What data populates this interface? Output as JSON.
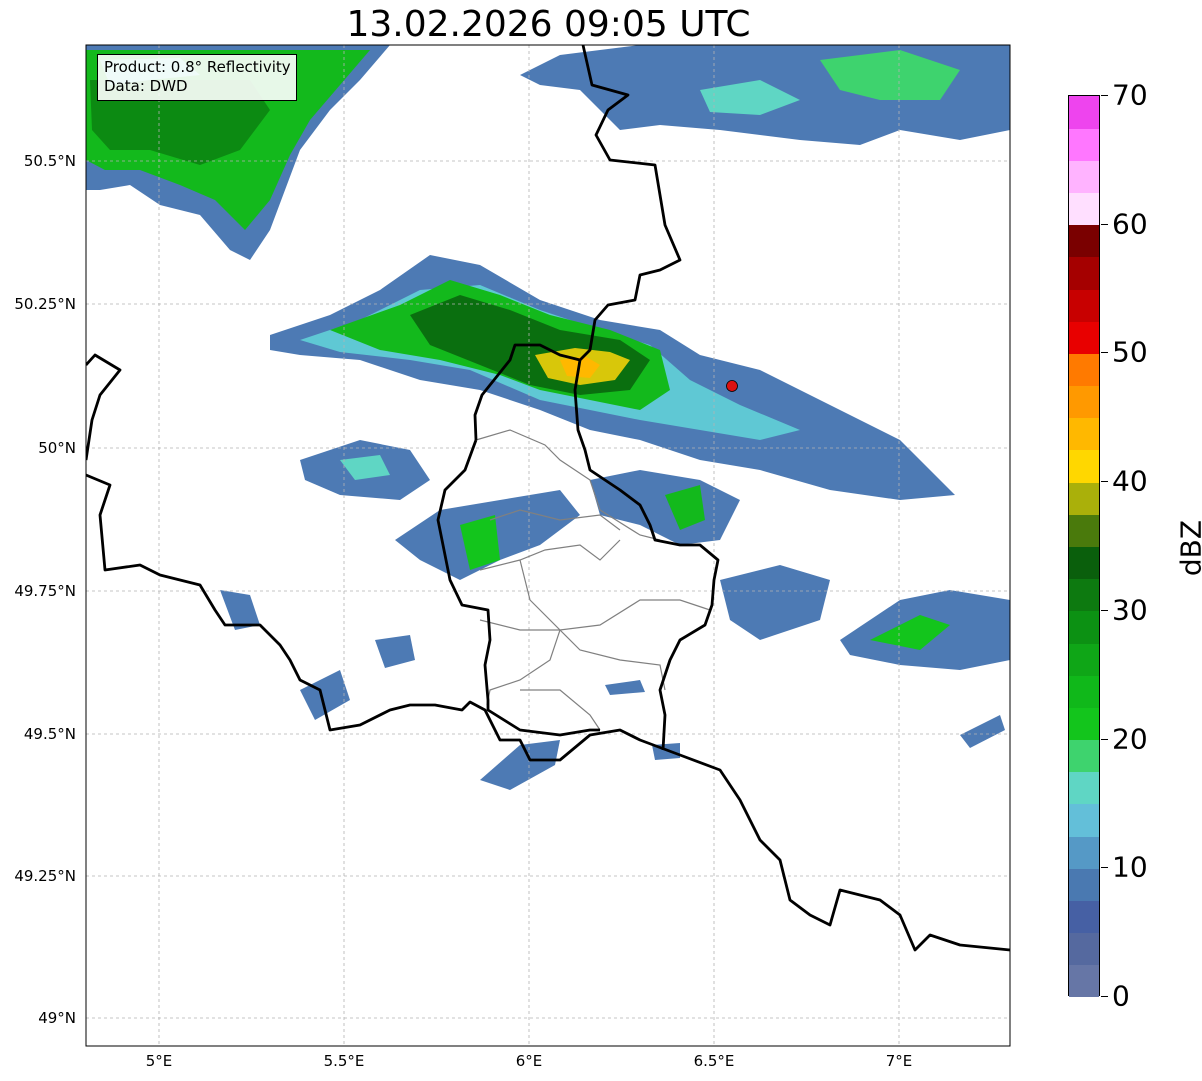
{
  "title": "13.02.2026 09:05 UTC",
  "infobox": {
    "line1": "Product: 0.8° Reflectivity",
    "line2": "Data: DWD"
  },
  "axes": {
    "x_ticks": [
      "5°E",
      "5.5°E",
      "6°E",
      "6.5°E",
      "7°E"
    ],
    "y_ticks": [
      "50.5°N",
      "50.25°N",
      "50°N",
      "49.75°N",
      "49.5°N",
      "49.25°N",
      "49°N"
    ],
    "lon_range": [
      4.8,
      7.3
    ],
    "lat_range": [
      48.95,
      50.7
    ]
  },
  "colorbar": {
    "label": "dBZ",
    "ticks": [
      "0",
      "10",
      "20",
      "30",
      "40",
      "50",
      "60",
      "70"
    ],
    "range": [
      0,
      70
    ],
    "step": 2.5,
    "colors": [
      "#6676a6",
      "#55699f",
      "#4660a4",
      "#4a79b1",
      "#5599c6",
      "#63bfd9",
      "#5fd6c4",
      "#3ed36e",
      "#13c51c",
      "#10b81a",
      "#0fa617",
      "#0c9113",
      "#0d7a10",
      "#0a5f0c",
      "#4a7a0c",
      "#aab00a",
      "#ffd700",
      "#ffb800",
      "#ff9900",
      "#ff7a00",
      "#e80000",
      "#c80000",
      "#a50000",
      "#7a0000",
      "#ffdfff",
      "#ffb3ff",
      "#ff77ff",
      "#ee44ee"
    ]
  },
  "marker": {
    "color": "#dd1111"
  },
  "grid": true
}
